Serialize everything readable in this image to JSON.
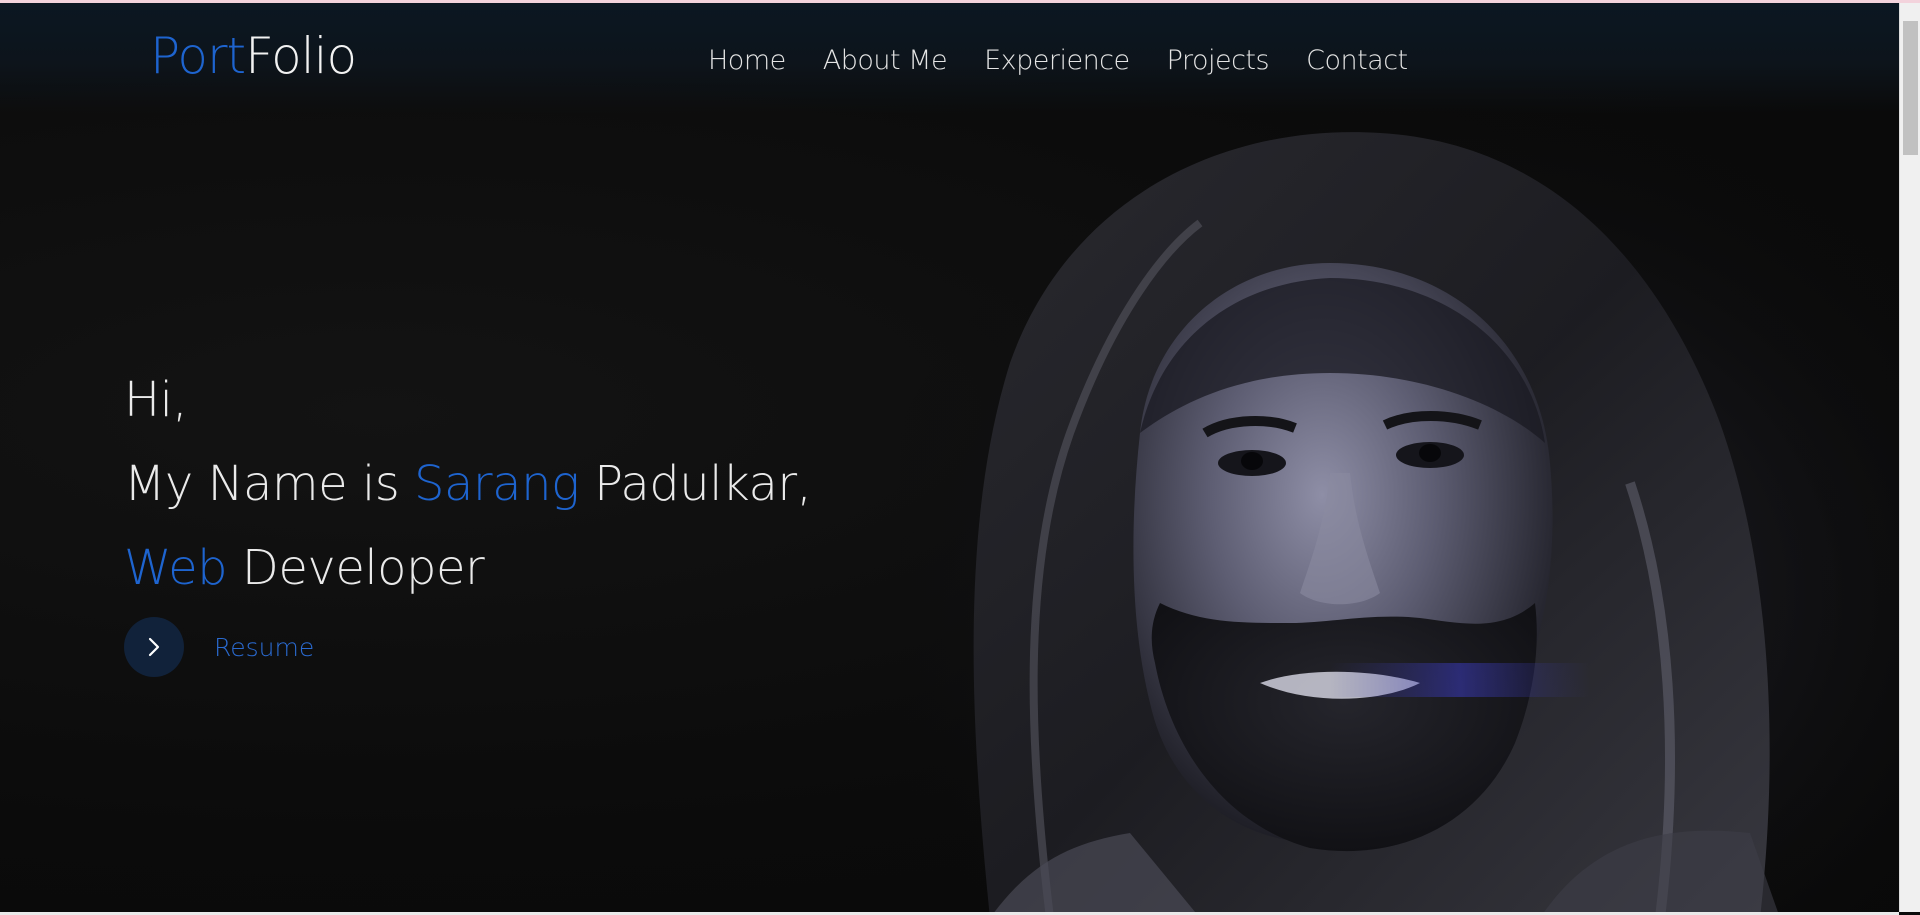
{
  "header": {
    "logo": {
      "part1": "Port",
      "part2": "Folio"
    },
    "nav": [
      {
        "label": "Home"
      },
      {
        "label": "About Me"
      },
      {
        "label": "Experience"
      },
      {
        "label": "Projects"
      },
      {
        "label": "Contact"
      }
    ]
  },
  "hero": {
    "greeting": "Hi,",
    "intro_prefix": "My Name is ",
    "first_name": "Sarang",
    "last_name_suffix": " Padulkar,",
    "role_accent": "Web",
    "role_rest": " Developer",
    "resume_label": "Resume",
    "resume_icon": "chevron-right-icon"
  },
  "colors": {
    "accent": "#1e64cf",
    "background": "#0c0c0c",
    "text": "#eaeaea"
  }
}
